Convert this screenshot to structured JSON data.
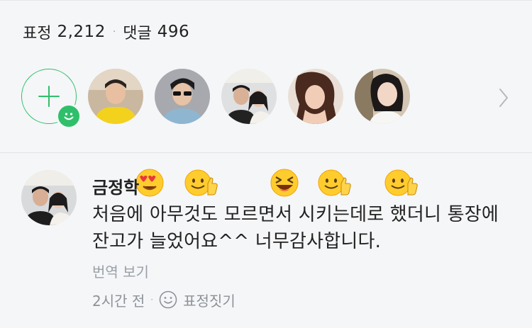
{
  "stats": {
    "expressions_label": "표정",
    "expressions_count": "2,212",
    "separator": "·",
    "comments_label": "댓글",
    "comments_count": "496"
  },
  "reactions": {
    "add_button_icon": "plus-icon",
    "accent_color": "#2fbf6b",
    "users": [
      {
        "emoji": "heart-eyes-emoji"
      },
      {
        "emoji": "thumbs-up-emoji"
      },
      {
        "emoji": "laughing-emoji"
      },
      {
        "emoji": "thumbs-up-emoji"
      },
      {
        "emoji": "thumbs-up-emoji"
      }
    ],
    "more_icon": "chevron-right-icon"
  },
  "comment": {
    "author": "금정학",
    "text": "처음에 아무것도 모르면서 시키는데로 했더니 통장에 잔고가 늘었어요^^ 너무감사합니다.",
    "translate_label": "번역 보기",
    "time": "2시간 전",
    "separator": "·",
    "react_label": "표정짓기"
  }
}
